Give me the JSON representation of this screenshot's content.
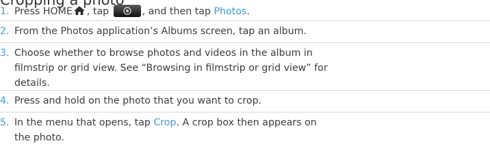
{
  "heading": "Cropping a photo",
  "steps": [
    {
      "number": "1.",
      "before": "Press HOME",
      "icon1": "home-icon",
      "mid": ", tap",
      "icon2": "camera-icon",
      "after": ", and then tap",
      "keyword": "Photos",
      "end": "."
    },
    {
      "number": "2.",
      "text": "From the Photos application’s Albums screen, tap an album."
    },
    {
      "number": "3.",
      "line1": "Choose whether to browse photos and videos in the album in",
      "line2": "filmstrip or grid view. See “Browsing in filmstrip or grid view” for",
      "line3": "details."
    },
    {
      "number": "4.",
      "text": "Press and hold on the photo that you want to crop."
    },
    {
      "number": "5.",
      "before": "In the menu that opens, tap",
      "keyword": "Crop",
      "after": ". A crop box then appears on",
      "line2": "the photo."
    }
  ],
  "colors": {
    "accent": "#3d9bd4",
    "text": "#3c3c3c",
    "divider": "#d6d6d6"
  }
}
